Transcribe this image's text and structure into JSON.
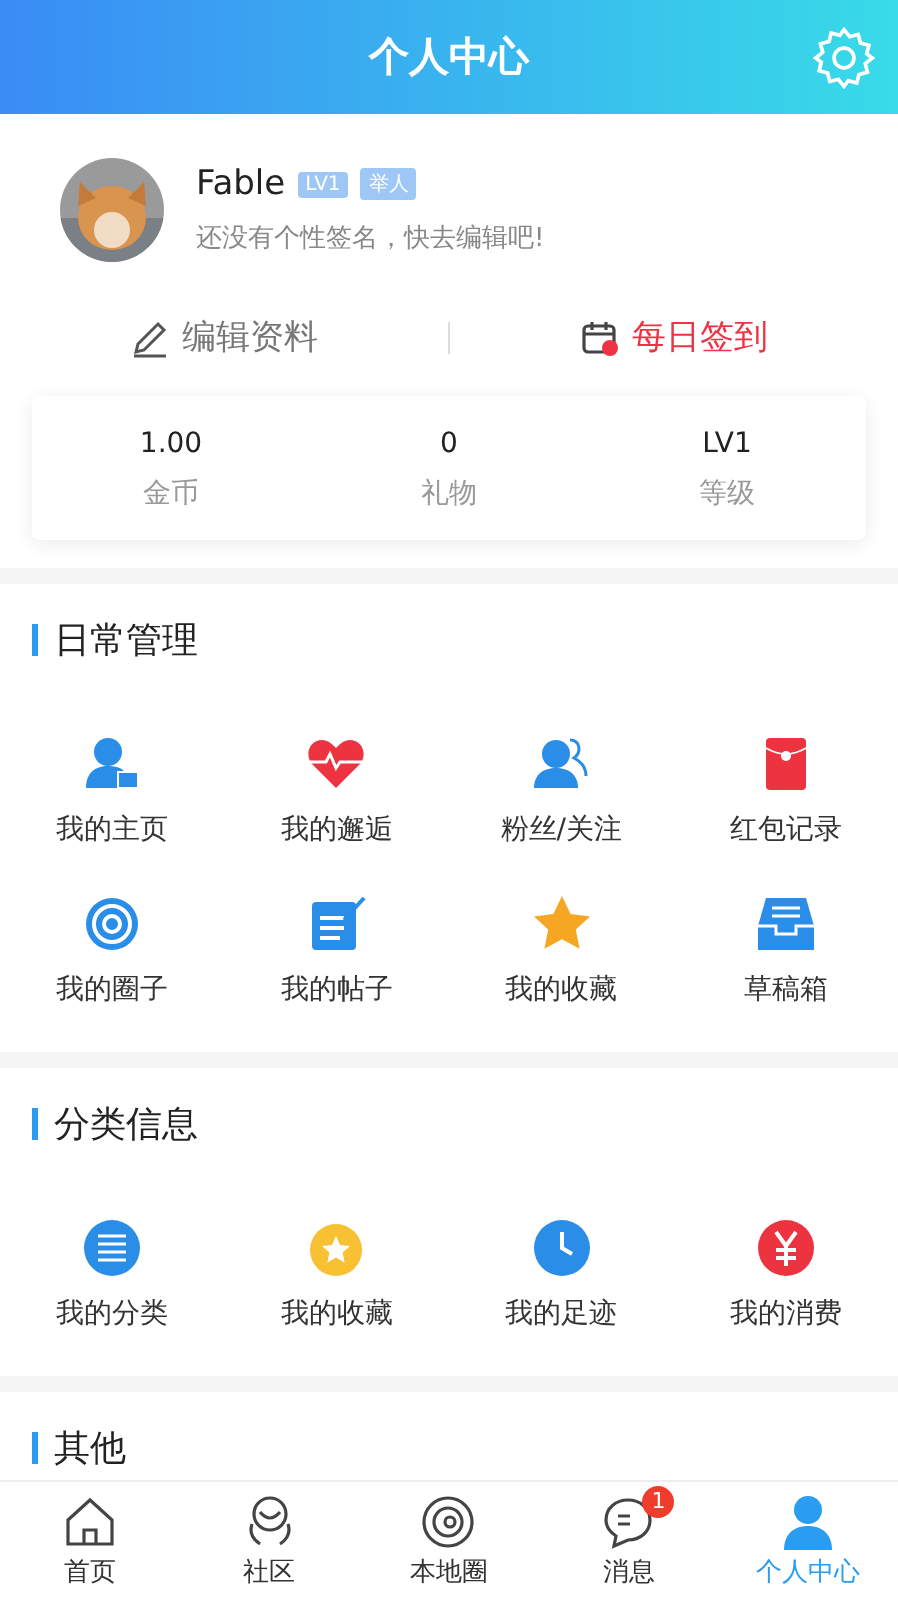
{
  "header": {
    "title": "个人中心"
  },
  "profile": {
    "name": "Fable",
    "badges": [
      "LV1",
      "举人"
    ],
    "signature": "还没有个性签名，快去编辑吧!"
  },
  "actions": [
    {
      "label": "编辑资料",
      "kind": "edit"
    },
    {
      "label": "每日签到",
      "kind": "checkin"
    }
  ],
  "stats": [
    {
      "value": "1.00",
      "label": "金币"
    },
    {
      "value": "0",
      "label": "礼物"
    },
    {
      "value": "LV1",
      "label": "等级"
    }
  ],
  "sections": [
    {
      "title": "日常管理",
      "items": [
        "我的主页",
        "我的邂逅",
        "粉丝/关注",
        "红包记录",
        "我的圈子",
        "我的帖子",
        "我的收藏",
        "草稿箱"
      ]
    },
    {
      "title": "分类信息",
      "items": [
        "我的分类",
        "我的收藏",
        "我的足迹",
        "我的消费"
      ]
    },
    {
      "title": "其他"
    }
  ],
  "tabbar": [
    {
      "label": "首页",
      "selected": false
    },
    {
      "label": "社区",
      "selected": false
    },
    {
      "label": "本地圈",
      "selected": false
    },
    {
      "label": "消息",
      "selected": false,
      "badge": "1"
    },
    {
      "label": "个人中心",
      "selected": true
    }
  ]
}
